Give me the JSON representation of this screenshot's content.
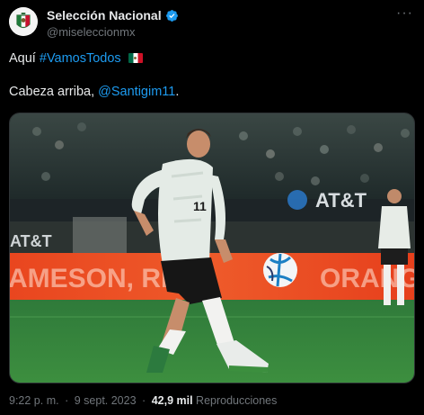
{
  "author": {
    "display_name": "Selección Nacional",
    "handle": "@miseleccionmx"
  },
  "more_icon": "more-dots-icon",
  "verified_icon": "verified-badge-icon",
  "tweet": {
    "line1_prefix": "Aquí",
    "hashtag": "#VamosTodos",
    "flag_emoji": "mexico-flag-icon",
    "line2_prefix": "Cabeza arriba,",
    "mention": "@Santigim11",
    "line2_suffix": "."
  },
  "media": {
    "ad_board_text": "AMESON, RE",
    "ad_board_text_right": "ORANG",
    "sponsor_text": "AT&T",
    "sponsor_text_left": "AT&T",
    "jersey_number": "11"
  },
  "footer": {
    "time": "9:22 p. m.",
    "date": "9 sept. 2023",
    "views_count": "42,9 mil",
    "views_label": "Reproducciones",
    "separator": "·"
  },
  "colors": {
    "link": "#1d9bf0",
    "verified": "#1d9bf0",
    "background": "#000000",
    "secondary_text": "#71767b"
  }
}
